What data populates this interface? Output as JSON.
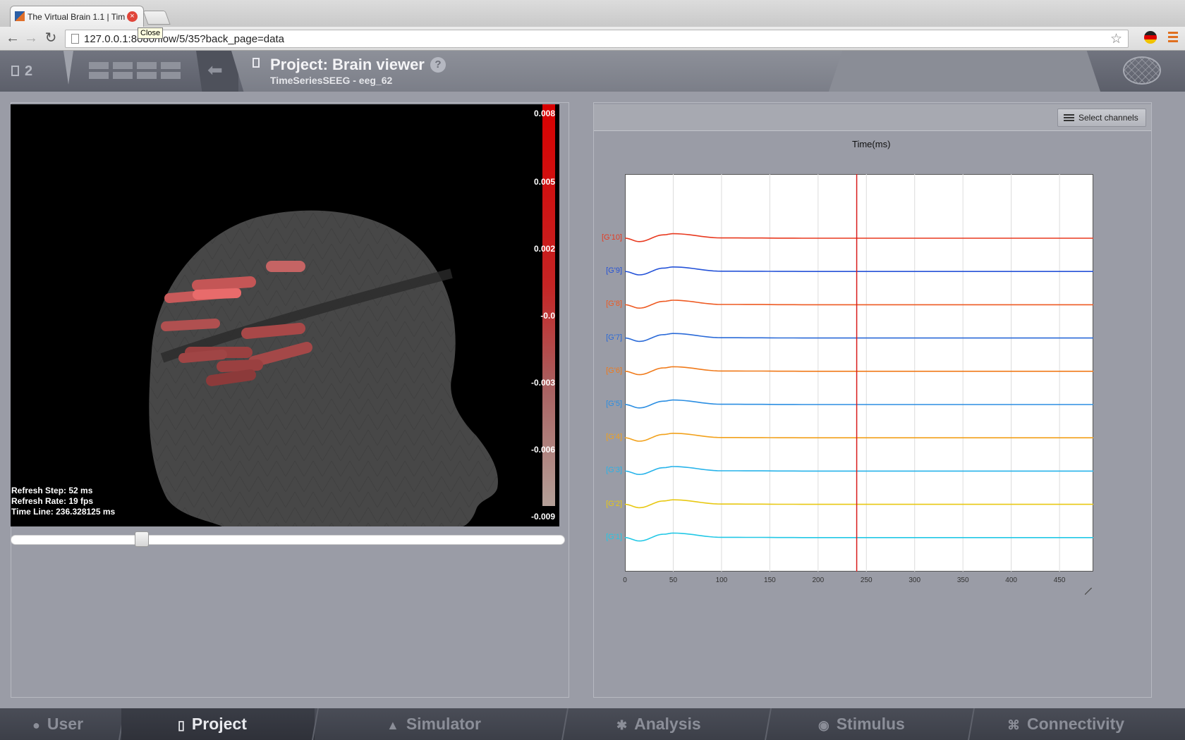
{
  "browser": {
    "tab_title": "The Virtual Brain 1.1 | Tim",
    "tab_close": "×",
    "tooltip": "Close",
    "url": "127.0.0.1:8080/flow/5/35?back_page=data",
    "back": "←",
    "forward": "→",
    "reload": "↻",
    "star": "☆"
  },
  "header": {
    "project_count": "2",
    "title": "Project: Brain viewer",
    "subtitle": "TimeSeriesSEEG - eeg_62",
    "help": "?",
    "back_arrow": "⬅"
  },
  "viewer3d": {
    "colorbar_labels": [
      "0.008",
      "0.005",
      "0.002",
      "-0.0",
      "-0.003",
      "-0.006",
      "-0.009"
    ],
    "refresh_step": "Refresh Step: 52 ms",
    "refresh_rate": "Refresh Rate: 19 fps",
    "time_line": "Time Line: 236.328125 ms",
    "slider_fraction": 0.23
  },
  "timeseries": {
    "select_channels": "Select channels",
    "x_title": "Time(ms)",
    "cursor_ms": 240,
    "channels": [
      {
        "label": "[G'10]",
        "color": "#e8391f"
      },
      {
        "label": "[G'9]",
        "color": "#2452d8"
      },
      {
        "label": "[G'8]",
        "color": "#ee5a22"
      },
      {
        "label": "[G'7]",
        "color": "#2a6ad8"
      },
      {
        "label": "[G'6]",
        "color": "#f07a1a"
      },
      {
        "label": "[G'5]",
        "color": "#2b8ee2"
      },
      {
        "label": "[G'4]",
        "color": "#f2a11b"
      },
      {
        "label": "[G'3]",
        "color": "#27b3ea"
      },
      {
        "label": "[G'2]",
        "color": "#e8c812"
      },
      {
        "label": "[G'1]",
        "color": "#22c8e6"
      }
    ]
  },
  "chart_data": {
    "type": "line",
    "title": "Time(ms)",
    "xlim": [
      0,
      485
    ],
    "x_ticks": [
      "0",
      "50",
      "100",
      "150",
      "200",
      "250",
      "300",
      "350",
      "400",
      "450"
    ],
    "cursor_x": 240,
    "grid": true,
    "series": [
      {
        "name": "[G'10]",
        "x": [
          0,
          15,
          40,
          50,
          100,
          200,
          485
        ],
        "values": [
          0,
          -0.6,
          0.6,
          0.8,
          0.05,
          0,
          0
        ]
      },
      {
        "name": "[G'9]",
        "x": [
          0,
          15,
          40,
          50,
          100,
          200,
          485
        ],
        "values": [
          0,
          -0.6,
          0.6,
          0.8,
          0.05,
          0,
          0
        ]
      },
      {
        "name": "[G'8]",
        "x": [
          0,
          15,
          40,
          50,
          100,
          200,
          485
        ],
        "values": [
          0,
          -0.6,
          0.6,
          0.8,
          0.05,
          0,
          0
        ]
      },
      {
        "name": "[G'7]",
        "x": [
          0,
          15,
          40,
          50,
          100,
          200,
          485
        ],
        "values": [
          0,
          -0.6,
          0.6,
          0.8,
          0.05,
          0,
          0
        ]
      },
      {
        "name": "[G'6]",
        "x": [
          0,
          15,
          40,
          50,
          100,
          200,
          485
        ],
        "values": [
          0,
          -0.6,
          0.6,
          0.8,
          0.05,
          0,
          0
        ]
      },
      {
        "name": "[G'5]",
        "x": [
          0,
          15,
          40,
          50,
          100,
          200,
          485
        ],
        "values": [
          0,
          -0.6,
          0.6,
          0.8,
          0.05,
          0,
          0
        ]
      },
      {
        "name": "[G'4]",
        "x": [
          0,
          15,
          40,
          50,
          100,
          200,
          485
        ],
        "values": [
          0,
          -0.6,
          0.6,
          0.8,
          0.05,
          0,
          0
        ]
      },
      {
        "name": "[G'3]",
        "x": [
          0,
          15,
          40,
          50,
          100,
          200,
          485
        ],
        "values": [
          0,
          -0.6,
          0.6,
          0.8,
          0.05,
          0,
          0
        ]
      },
      {
        "name": "[G'2]",
        "x": [
          0,
          15,
          40,
          50,
          100,
          200,
          485
        ],
        "values": [
          0,
          -0.6,
          0.6,
          0.8,
          0.05,
          0,
          0
        ]
      },
      {
        "name": "[G'1]",
        "x": [
          0,
          15,
          40,
          50,
          100,
          200,
          485
        ],
        "values": [
          0,
          -0.6,
          0.6,
          0.8,
          0.05,
          0,
          0
        ]
      }
    ]
  },
  "nav": {
    "user": "User",
    "project": "Project",
    "simulator": "Simulator",
    "analysis": "Analysis",
    "stimulus": "Stimulus",
    "connectivity": "Connectivity"
  },
  "colors": {
    "cursor": "#d81c1c",
    "accent_active": "#e9eaee"
  }
}
